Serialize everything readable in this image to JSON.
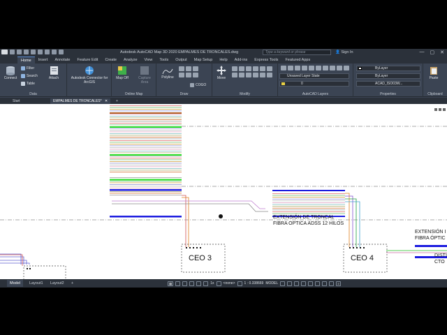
{
  "titlebar": {
    "title": "Autodesk AutoCAD Map 3D 2020    EMPALMES DE TRONCALES.dwg",
    "search_placeholder": "Type a keyword or phrase",
    "sign_in": "Sign In",
    "window_buttons": [
      "—",
      "▢",
      "✕"
    ]
  },
  "ribbon_tabs": [
    "Home",
    "Insert",
    "Annotate",
    "Feature Edit",
    "Create",
    "Analyze",
    "View",
    "Tools",
    "Output",
    "Map Setup",
    "Help",
    "Add-ins",
    "Express Tools",
    "Featured Apps"
  ],
  "ribbon": {
    "data_panel": {
      "label": "Data",
      "connect": "Connect",
      "filter": "Filter",
      "search": "Search",
      "table": "Table",
      "attach": "Attach"
    },
    "arcgis": {
      "label": "Autodesk Connector for ArcGIS"
    },
    "online_map": {
      "label": "Online Map",
      "map_off": "Map Off",
      "capture_area": "Capture Area"
    },
    "draw": {
      "label": "Draw",
      "polyline": "Polyline",
      "cogo": "COGO"
    },
    "modify": {
      "label": "Modify",
      "move": "Move"
    },
    "layers": {
      "label": "AutoCAD Layers",
      "layer_state": "Unsaved Layer State",
      "layer_value": "0"
    },
    "properties": {
      "label": "Properties",
      "color": "ByLayer",
      "linetype": "ByLayer",
      "lineweight": "ACAD_ISO03W..."
    },
    "clipboard": {
      "label": "Clipboard",
      "paste": "Paste"
    }
  },
  "file_tabs": {
    "start": "Start",
    "active": "EMPALMES DE TRONCALES*",
    "close": "✕",
    "add": "+"
  },
  "drawing": {
    "text_ext_1a": "EXTENSIÓN DE TRONCAL",
    "text_ext_1b": "FIBRA OPTICA ADSS 12 HILOS",
    "text_ext_2a": "EXTENSIÓN I",
    "text_ext_2b": "FIBRA ÓPTIC",
    "text_dist": "DISTI",
    "text_cto": "CTO",
    "ceo3": "CEO 3",
    "ceo4": "CEO 4"
  },
  "layout_tabs": [
    "Model",
    "Layout1",
    "Layout2",
    "+"
  ],
  "status": {
    "none": "<none>",
    "scale": "1 : 0.338669",
    "model": "MODEL",
    "zoom": "1x"
  },
  "colors": {
    "ribbon_bg": "#3b4453",
    "titlebar_bg": "#2b313a",
    "canvas_bg": "#ffffff",
    "blue_line": "#1a1adf",
    "green_line": "#22dd22",
    "brown_line": "#b05a20"
  }
}
